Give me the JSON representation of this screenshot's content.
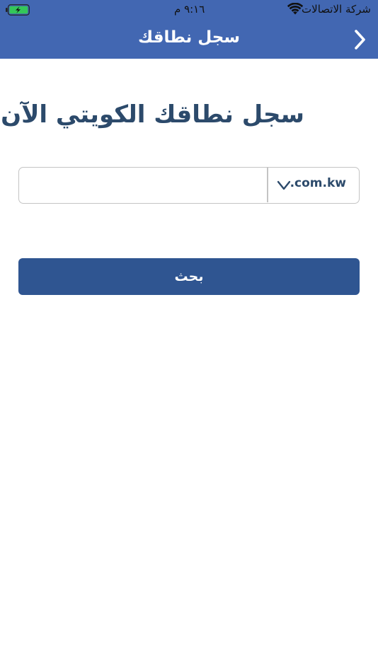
{
  "status_bar": {
    "carrier": "شركة الاتصالات",
    "time": "٩:١٦ م",
    "wifi_icon": "wifi-icon",
    "battery_icon": "battery-charging-icon"
  },
  "nav": {
    "title": "سجل نطاقك",
    "back_icon": "chevron-right-icon"
  },
  "main": {
    "heading": "سجل نطاقك الكويتي الآن",
    "domain_input": {
      "value": "",
      "placeholder": ""
    },
    "extension_select": {
      "selected": ".com.kw",
      "icon": "chevron-down-icon"
    },
    "search_button": "بحث"
  },
  "colors": {
    "header": "#4267b2",
    "button": "#2f5591",
    "heading_text": "#2c4a6b",
    "battery": "#34c759"
  }
}
